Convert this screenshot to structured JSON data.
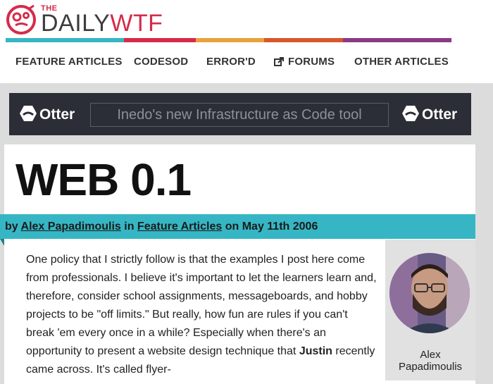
{
  "logo": {
    "the": "THE",
    "daily": "DAILY",
    "wtf": "WTF"
  },
  "stripe_colors": [
    "#36b6c4",
    "#d52b4a",
    "#e8a33d",
    "#d8572a",
    "#8b3a87"
  ],
  "nav": {
    "items": [
      "FEATURE ARTICLES",
      "CODESOD",
      "ERROR'D",
      "FORUMS",
      "OTHER ARTICLES"
    ],
    "forums_icon": "external-link-icon"
  },
  "ad": {
    "brand": "Otter",
    "tagline": "Inedo's new Infrastructure as Code tool"
  },
  "article": {
    "title": "WEB 0.1",
    "byline": {
      "by": "by",
      "author": "Alex Papadimoulis",
      "in": "in",
      "category": "Feature Articles",
      "on": "on May 11th 2006"
    },
    "paragraph_before_bold": "One policy that I strictly follow is that the examples I post here come from professionals. I believe it's important to let the learners learn and, therefore, consider school assignments, messageboards, and hobby projects to be \"off limits.\" But really, how fun are rules if you can't break 'em every once in a while? Especially when there's an opportunity to present a website design technique that ",
    "bold_name": "Justin",
    "paragraph_after_bold": " recently came across. It's called flyer-"
  },
  "author_box": {
    "name_line1": "Alex",
    "name_line2": "Papadimoulis"
  },
  "colors": {
    "accent_teal": "#36b6c4",
    "brand_red": "#d52b4a",
    "ad_background": "#2c2e37"
  }
}
